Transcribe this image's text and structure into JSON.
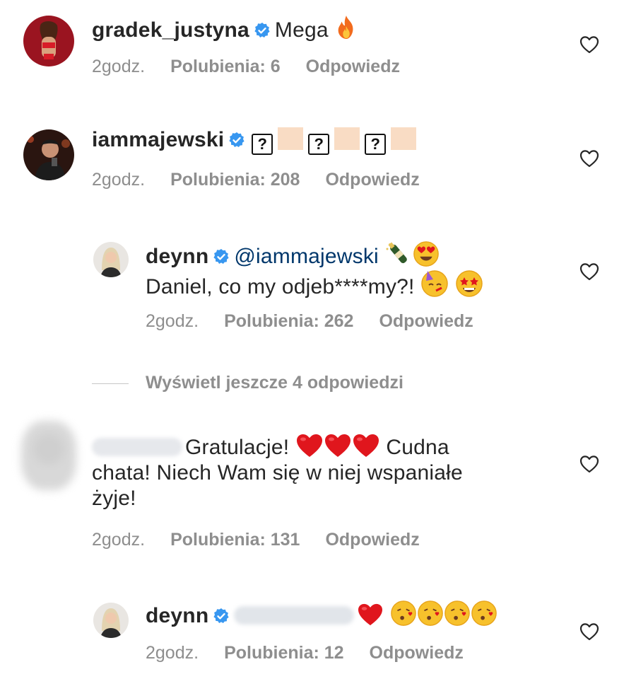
{
  "comments": [
    {
      "username": "gradek_justyna",
      "text": "Mega",
      "emoji_icons": [
        "fire-icon"
      ],
      "time": "2godz.",
      "likes": "Polubienia: 6",
      "reply": "Odpowiedz"
    },
    {
      "username": "iammajewski",
      "text_glyphs": [
        "?",
        "skin-tone",
        "?",
        "skin-tone",
        "?",
        "skin-tone"
      ],
      "time": "2godz.",
      "likes": "Polubienia: 208",
      "reply": "Odpowiedz"
    },
    {
      "username": "deynn",
      "mention": "@iammajewski",
      "emoji_icons_line1": [
        "champagne-icon",
        "heart-eyes-icon"
      ],
      "text": "Daniel, co my odjeb****my?!",
      "emoji_icons_line2": [
        "party-face-icon",
        "star-struck-icon"
      ],
      "time": "2godz.",
      "likes": "Polubienia: 262",
      "reply": "Odpowiedz"
    },
    {
      "text_part1": "Gratulacje!",
      "emoji_icons": [
        "red-heart-icon",
        "red-heart-icon",
        "red-heart-icon"
      ],
      "text_part2": "Cudna",
      "text_line2": "chata! Niech Wam się w niej wspaniałe",
      "text_line3": "żyje!",
      "time": "2godz.",
      "likes": "Polubienia: 131",
      "reply": "Odpowiedz"
    },
    {
      "username": "deynn",
      "emoji_icons": [
        "red-heart-icon",
        "kissing-face-icon",
        "kissing-face-icon",
        "kissing-face-icon",
        "kissing-face-icon"
      ],
      "time": "2godz.",
      "likes": "Polubienia: 12",
      "reply": "Odpowiedz"
    }
  ],
  "view_more": "Wyświetl jeszcze 4 odpowiedzi",
  "colors": {
    "text": "#262626",
    "meta": "#8e8e8e",
    "mention": "#00376b",
    "verified": "#3897f0",
    "heart_red": "#e0161d",
    "emoji_yellow": "#f7c12c"
  }
}
